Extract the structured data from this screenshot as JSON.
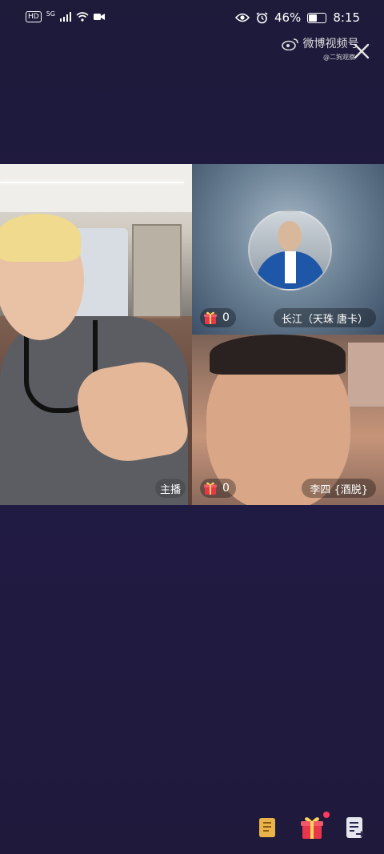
{
  "status_bar": {
    "hd": "HD",
    "network": "5G",
    "battery": "46%",
    "battery_level": 0.46,
    "time": "8:15"
  },
  "watermark": {
    "brand": "微博视频号",
    "handle": "@二狗观察"
  },
  "tiles": {
    "host": {
      "role_label": "主播"
    },
    "guest1": {
      "gift_count": "0",
      "name": "长江（天珠 唐卡）"
    },
    "guest2": {
      "gift_count": "0",
      "name": "李四 {酒脱}"
    }
  },
  "colors": {
    "background": "#1f1a3c",
    "badge_bg": "rgba(0,0,0,0.32)",
    "gift_red": "#e8374b",
    "notify_dot": "#ff3b5c"
  },
  "bottom_actions": [
    {
      "icon": "scroll-icon"
    },
    {
      "icon": "gift-icon",
      "has_dot": true
    },
    {
      "icon": "list-share-icon"
    }
  ]
}
